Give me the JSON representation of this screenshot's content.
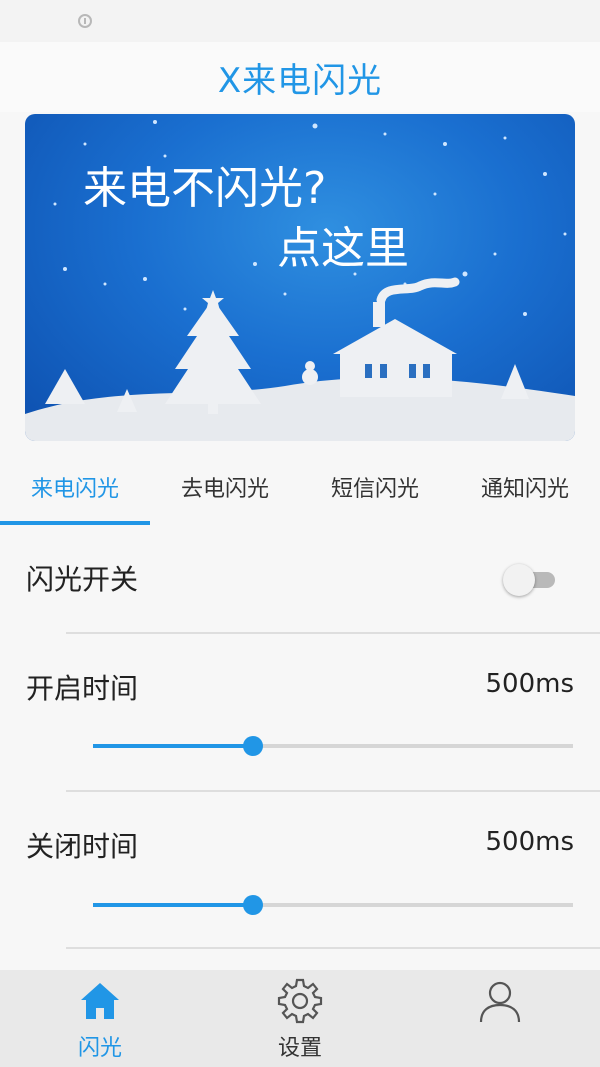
{
  "app": {
    "title": "X来电闪光"
  },
  "banner": {
    "line1": "来电不闪光?",
    "line2": "点这里"
  },
  "tabs": [
    {
      "label": "来电闪光",
      "active": true
    },
    {
      "label": "去电闪光",
      "active": false
    },
    {
      "label": "短信闪光",
      "active": false
    },
    {
      "label": "通知闪光",
      "active": false
    }
  ],
  "settings": {
    "flash_switch": {
      "label": "闪光开关",
      "on": false
    },
    "on_time": {
      "label": "开启时间",
      "value": "500ms",
      "slider_fraction": 0.333
    },
    "off_time": {
      "label": "关闭时间",
      "value": "500ms",
      "slider_fraction": 0.333
    }
  },
  "bottom_nav": [
    {
      "label": "闪光",
      "icon": "home-icon",
      "active": true
    },
    {
      "label": "设置",
      "icon": "gear-icon",
      "active": false
    },
    {
      "label": "",
      "icon": "user-icon",
      "active": false
    }
  ],
  "colors": {
    "accent": "#2196e6",
    "inactive_track": "#b9b9b9",
    "nav_background": "#e9e9e9"
  }
}
